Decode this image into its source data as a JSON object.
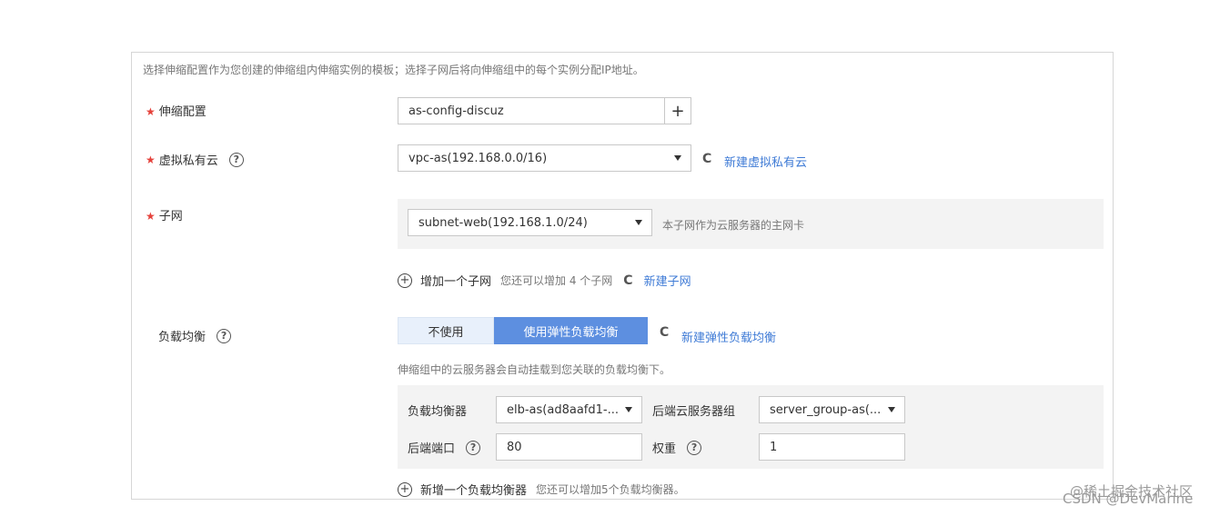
{
  "intro_text": "选择伸缩配置作为您创建的伸缩组内伸缩实例的模板；选择子网后将向伸缩组中的每个实例分配IP地址。",
  "required_mark": "★",
  "as_config": {
    "label": "伸缩配置",
    "value": "as-config-discuz",
    "add_symbol": "+"
  },
  "vpc": {
    "label": "虚拟私有云",
    "help_symbol": "?",
    "value": "vpc-as(192.168.0.0/16)",
    "refresh_symbol": "C",
    "create_link": "新建虚拟私有云"
  },
  "subnet": {
    "label": "子网",
    "value": "subnet-web(192.168.1.0/24)",
    "note": "本子网作为云服务器的主网卡",
    "add_label": "增加一个子网",
    "add_hint": "您还可以增加 4 个子网",
    "refresh_symbol": "C",
    "create_link": "新建子网"
  },
  "lb": {
    "label": "负载均衡",
    "help_symbol": "?",
    "options": [
      "不使用",
      "使用弹性负载均衡"
    ],
    "selected": "使用弹性负载均衡",
    "refresh_symbol": "C",
    "create_link": "新建弹性负载均衡",
    "description": "伸缩组中的云服务器会自动挂载到您关联的负载均衡下。",
    "balancer_label": "负载均衡器",
    "balancer_value": "elb-as(ad8aafd1-...",
    "backend_group_label": "后端云服务器组",
    "backend_group_value": "server_group-as(...",
    "backend_port_label": "后端端口",
    "backend_port_value": "80",
    "weight_label": "权重",
    "weight_value": "1",
    "add_label": "新增一个负载均衡器",
    "add_hint": "您还可以增加5个负载均衡器。"
  },
  "watermark": {
    "line1": "@稀土掘金技术社区",
    "line2": "CSDN @DevMarine"
  },
  "icons": {
    "add": "plus-circle-icon",
    "refresh": "refresh-icon",
    "help": "question-circle-icon",
    "dropdown": "chevron-down-icon"
  },
  "colors": {
    "required": "#e5423b",
    "link": "#3f7bd6",
    "primary_selected": "#5d8fe0",
    "segment_unselected": "#e8f0fb",
    "gray_section": "#f3f3f3"
  }
}
